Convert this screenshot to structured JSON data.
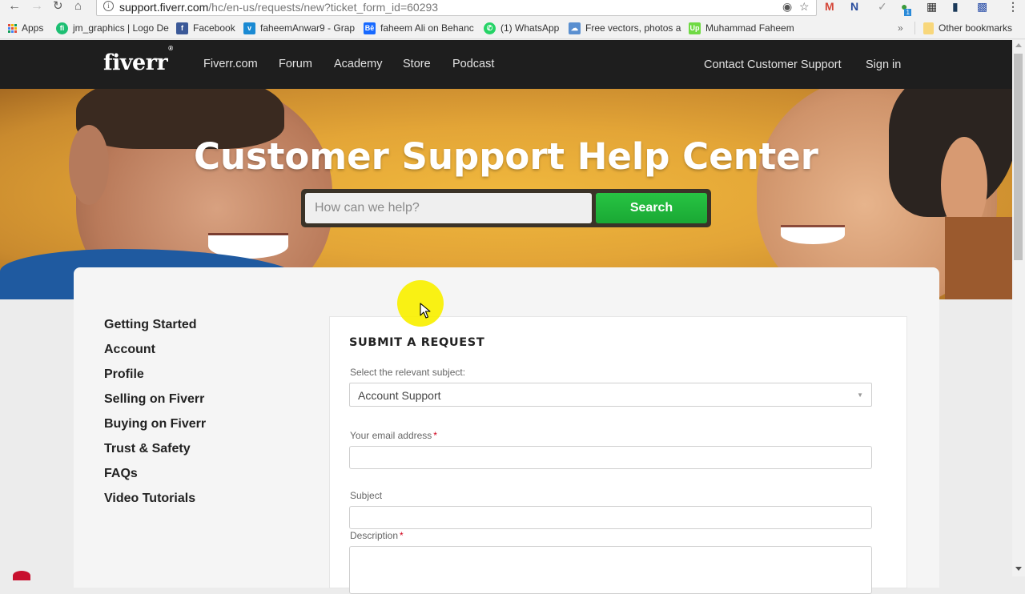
{
  "browser": {
    "url_host": "support.fiverr.com",
    "url_path": "/hc/en-us/requests/new?ticket_form_id=60293",
    "icons": [
      "back-icon",
      "forward-icon",
      "reload-icon",
      "home-icon",
      "info-icon",
      "extension-icon",
      "star-icon",
      "gmail-icon",
      "onenote-icon",
      "check-icon",
      "extension-badge-icon",
      "film-icon",
      "book-icon",
      "grid-icon",
      "menu-icon"
    ],
    "extension_badge": "1",
    "bookmarks": [
      {
        "label": "Apps",
        "icon": "apps-grid-icon",
        "color": "#e04c3c"
      },
      {
        "label": "jm_graphics | Logo De",
        "icon": "fiverr-green-icon",
        "color": "#1dbf73"
      },
      {
        "label": "Facebook",
        "icon": "facebook-icon",
        "color": "#3b5998"
      },
      {
        "label": "faheemAnwar9 - Grap",
        "icon": "vimeo-icon",
        "color": "#1a8ad3"
      },
      {
        "label": "faheem Ali on Behanc",
        "icon": "behance-icon",
        "color": "#1769ff"
      },
      {
        "label": "(1) WhatsApp",
        "icon": "whatsapp-icon",
        "color": "#25d366"
      },
      {
        "label": "Free vectors, photos a",
        "icon": "freepik-icon",
        "color": "#5a8fd0"
      },
      {
        "label": "Muhammad Faheem",
        "icon": "upwork-icon",
        "color": "#6fda44"
      }
    ],
    "overflow_label": "»",
    "other_bookmarks": "Other bookmarks"
  },
  "header": {
    "logo": "fiverr",
    "logo_mark": "®",
    "nav": [
      "Fiverr.com",
      "Forum",
      "Academy",
      "Store",
      "Podcast"
    ],
    "contact": "Contact Customer Support",
    "signin": "Sign in"
  },
  "hero": {
    "title": "Customer Support Help Center",
    "search_placeholder": "How can we help?",
    "search_button": "Search"
  },
  "sidebar": {
    "items": [
      "Getting Started",
      "Account",
      "Profile",
      "Selling on Fiverr",
      "Buying on Fiverr",
      "Trust & Safety",
      "FAQs",
      "Video Tutorials"
    ]
  },
  "form": {
    "title": "SUBMIT A REQUEST",
    "subject_select_label": "Select the relevant subject:",
    "subject_select_value": "Account Support",
    "email_label": "Your email address",
    "email_value": "",
    "subject_label": "Subject",
    "subject_value": "",
    "description_label": "Description",
    "required_mark": "*"
  },
  "colors": {
    "header_bg": "#1e1e1e",
    "search_button": "#1fb53a",
    "required": "#d0021b",
    "cursor_highlight": "#f8f000"
  }
}
